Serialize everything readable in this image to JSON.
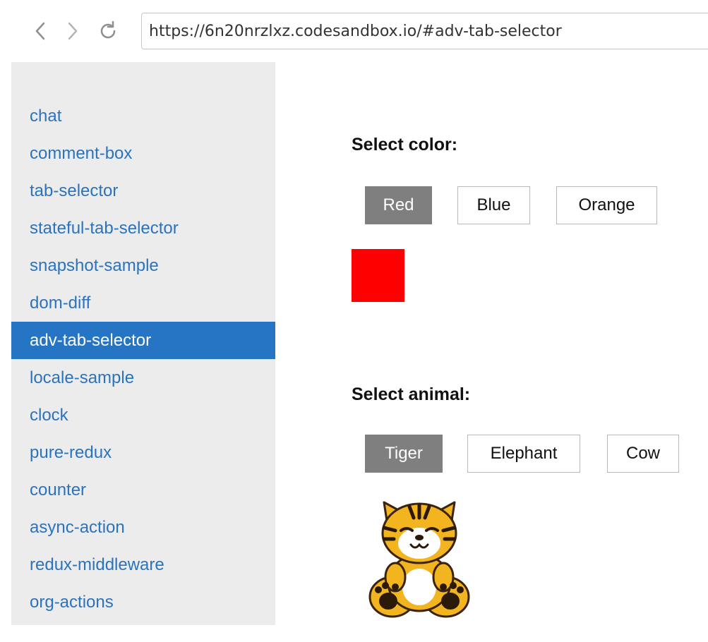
{
  "browser": {
    "url": "https://6n20nrzlxz.codesandbox.io/#adv-tab-selector",
    "back_icon": "chevron-left-icon",
    "forward_icon": "chevron-right-icon",
    "reload_icon": "reload-icon"
  },
  "sidebar": {
    "items": [
      {
        "label": "chat"
      },
      {
        "label": "comment-box"
      },
      {
        "label": "tab-selector"
      },
      {
        "label": "stateful-tab-selector"
      },
      {
        "label": "snapshot-sample"
      },
      {
        "label": "dom-diff"
      },
      {
        "label": "adv-tab-selector",
        "active": true
      },
      {
        "label": "locale-sample"
      },
      {
        "label": "clock"
      },
      {
        "label": "pure-redux"
      },
      {
        "label": "counter"
      },
      {
        "label": "async-action"
      },
      {
        "label": "redux-middleware"
      },
      {
        "label": "org-actions"
      }
    ],
    "active_color": "#2674c4",
    "link_color": "#2a73be"
  },
  "color_selector": {
    "title": "Select color:",
    "options": [
      "Red",
      "Blue",
      "Orange"
    ],
    "selected": "Red",
    "swatch_color": "#ff0000"
  },
  "animal_selector": {
    "title": "Select animal:",
    "options": [
      "Tiger",
      "Elephant",
      "Cow"
    ],
    "selected": "Tiger",
    "image_icon": "tiger-illustration"
  }
}
